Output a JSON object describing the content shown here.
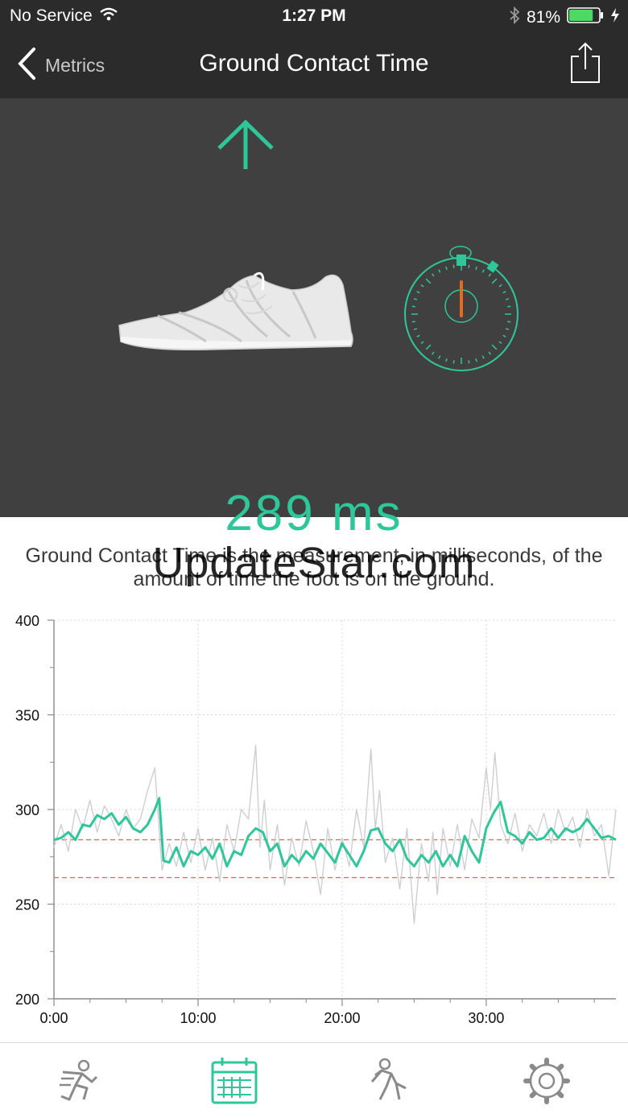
{
  "status_bar": {
    "carrier": "No Service",
    "time": "1:27 PM",
    "battery": "81%",
    "battery_level": 0.81,
    "icons": [
      "wifi-icon",
      "bluetooth-icon",
      "battery-icon",
      "charging-icon"
    ]
  },
  "nav": {
    "back_label": "Metrics",
    "title": "Ground Contact Time",
    "icons": [
      "chevron-left-icon",
      "share-icon"
    ]
  },
  "hero": {
    "value": "289 ms",
    "icons": [
      "arrow-up-icon",
      "shoe-icon",
      "stopwatch-icon"
    ]
  },
  "description": "Ground Contact Time is the measurement, in milliseconds, of the amount of time the foot is on the ground.",
  "watermark": "UpdateStar.com",
  "chart_data": {
    "type": "line",
    "x_tick_labels": [
      "0:00",
      "10:00",
      "20:00",
      "30:00"
    ],
    "y_tick_labels": [
      "400",
      "350",
      "300",
      "250",
      "200"
    ],
    "xlim": [
      0,
      39
    ],
    "ylim": [
      200,
      400
    ],
    "grid": true,
    "reference_lines": [
      284,
      264
    ],
    "series": [
      {
        "style": "raw",
        "x": [
          0,
          0.5,
          1,
          1.5,
          2,
          2.5,
          3,
          3.5,
          4,
          4.5,
          5,
          5.5,
          6,
          6.5,
          7,
          7.2,
          7.5,
          8,
          8.5,
          9,
          9.5,
          10,
          10.5,
          11,
          11.5,
          12,
          12.5,
          13,
          13.5,
          14,
          14.3,
          14.6,
          15,
          15.5,
          16,
          16.5,
          17,
          17.5,
          18,
          18.5,
          19,
          19.5,
          20,
          20.5,
          21,
          21.5,
          22,
          22.3,
          22.6,
          23,
          23.5,
          24,
          24.5,
          25,
          25.5,
          26,
          26.3,
          26.6,
          27,
          27.5,
          28,
          28.5,
          29,
          29.5,
          30,
          30.3,
          30.6,
          31,
          31.5,
          32,
          32.5,
          33,
          33.5,
          34,
          34.5,
          35,
          35.5,
          36,
          36.5,
          37,
          37.5,
          38,
          38.5,
          39
        ],
        "y": [
          280,
          292,
          278,
          300,
          290,
          305,
          288,
          302,
          295,
          286,
          300,
          290,
          295,
          310,
          322,
          300,
          268,
          282,
          270,
          288,
          272,
          290,
          268,
          285,
          262,
          292,
          278,
          300,
          295,
          334,
          280,
          305,
          268,
          292,
          260,
          285,
          270,
          294,
          278,
          255,
          290,
          268,
          285,
          270,
          300,
          280,
          332,
          290,
          310,
          272,
          285,
          258,
          290,
          240,
          282,
          262,
          288,
          255,
          290,
          270,
          292,
          268,
          295,
          285,
          322,
          300,
          330,
          292,
          282,
          298,
          278,
          292,
          286,
          298,
          282,
          300,
          288,
          296,
          280,
          300,
          286,
          292,
          265,
          300
        ]
      },
      {
        "style": "smoothed",
        "x": [
          0,
          0.5,
          1,
          1.5,
          2,
          2.5,
          3,
          3.5,
          4,
          4.5,
          5,
          5.5,
          6,
          6.5,
          7,
          7.3,
          7.6,
          8,
          8.5,
          9,
          9.5,
          10,
          10.5,
          11,
          11.5,
          12,
          12.5,
          13,
          13.5,
          14,
          14.5,
          15,
          15.5,
          16,
          16.5,
          17,
          17.5,
          18,
          18.5,
          19,
          19.5,
          20,
          20.5,
          21,
          21.5,
          22,
          22.5,
          23,
          23.5,
          24,
          24.5,
          25,
          25.5,
          26,
          26.5,
          27,
          27.5,
          28,
          28.5,
          29,
          29.5,
          30,
          30.5,
          31,
          31.5,
          32,
          32.5,
          33,
          33.5,
          34,
          34.5,
          35,
          35.5,
          36,
          36.5,
          37,
          37.5,
          38,
          38.5,
          39
        ],
        "y": [
          284,
          285,
          288,
          284,
          292,
          291,
          297,
          295,
          298,
          292,
          296,
          290,
          288,
          292,
          300,
          306,
          273,
          272,
          280,
          270,
          278,
          276,
          280,
          274,
          282,
          270,
          278,
          276,
          286,
          290,
          288,
          278,
          282,
          270,
          276,
          272,
          278,
          274,
          282,
          277,
          272,
          282,
          276,
          270,
          278,
          289,
          290,
          282,
          278,
          284,
          274,
          270,
          276,
          272,
          278,
          270,
          276,
          270,
          286,
          278,
          272,
          290,
          298,
          304,
          288,
          286,
          282,
          288,
          284,
          285,
          290,
          285,
          290,
          288,
          290,
          295,
          290,
          285,
          286,
          284
        ]
      }
    ]
  }
}
